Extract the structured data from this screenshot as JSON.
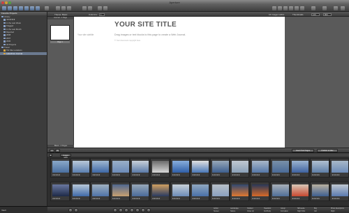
{
  "window": {
    "title": "Aperture"
  },
  "sidebar": {
    "header": "Favorite Projects",
    "items": [
      {
        "label": "Library",
        "sel": false
      },
      {
        "label": "★★★★★",
        "sel": false
      },
      {
        "label": "In the Last Week",
        "sel": false
      },
      {
        "label": "Flagged",
        "sel": false
      },
      {
        "label": "In the Last Month",
        "sel": false
      },
      {
        "label": "Rejected",
        "sel": false
      },
      {
        "label": "2008",
        "sel": false
      },
      {
        "label": "2007",
        "sel": false
      },
      {
        "label": "2006",
        "sel": false
      },
      {
        "label": "All Projects",
        "sel": false
      },
      {
        "label": "Travel",
        "sel": false
      },
      {
        "label": "Tiki Site Locations",
        "sel": false
      },
      {
        "label": "Lakeshore Journal",
        "sel": true
      }
    ],
    "footer": "Vault"
  },
  "book_toolbar": {
    "theme_label": "Theme: Basic",
    "columns_label": "Columns:",
    "columns_value": "1",
    "images_label": "16 images within",
    "thumb_label": "Thumbnails",
    "size_value": "120",
    "size_value2": "800"
  },
  "pages_panel": {
    "header": "Journal - 1 Page",
    "thumb_label": "Page 1",
    "footer": "Blank - 4 Pages"
  },
  "canvas": {
    "title": "YOUR SITE TITLE",
    "subtitle": "Your site subtitle",
    "drag_text": "Drag images or text blocks to this page to create a Web Journal.",
    "copyright": "© Your document copyright here"
  },
  "browser_toolbar": {
    "insert_label": "Insert Text Pages",
    "publish_label": "Publish to Mac",
    "filter_label": "Images Grid"
  },
  "browser": {
    "thumbnails": [
      {
        "rating": "★★★★★",
        "c1": "#4a6fa0",
        "c2": "#8aa8c8"
      },
      {
        "rating": "★★★★★",
        "c1": "#5b7fb0",
        "c2": "#b8c8d8"
      },
      {
        "rating": "★★★★★",
        "c1": "#3e68a6",
        "c2": "#a0b8d0"
      },
      {
        "rating": "★★★★★",
        "c1": "#6b8ab8",
        "c2": "#9ab0c8"
      },
      {
        "rating": "★★★★★",
        "c1": "#5a7aa8",
        "c2": "#c8d0d8"
      },
      {
        "rating": "★★★★★",
        "c1": "#d8d8d8",
        "c2": "#6a6a6a"
      },
      {
        "rating": "★★★★★",
        "c1": "#2f5fa8",
        "c2": "#88aedc"
      },
      {
        "rating": "★★★★★",
        "c1": "#4a78b8",
        "c2": "#e0e0e0"
      },
      {
        "rating": "★★★★★",
        "c1": "#3d5f8f",
        "c2": "#98a8b8"
      },
      {
        "rating": "★★★★★",
        "c1": "#8aa0b8",
        "c2": "#c0c8d0"
      },
      {
        "rating": "★★★★★",
        "c1": "#5577a8",
        "c2": "#aab8c8"
      },
      {
        "rating": "★★★★★",
        "c1": "#4a6a98",
        "c2": "#7890a8"
      },
      {
        "rating": "★★★★★",
        "c1": "#3e62a0",
        "c2": "#9cb4d0"
      },
      {
        "rating": "★★★★★",
        "c1": "#5f7fa8",
        "c2": "#b0c0d0"
      },
      {
        "rating": "★★★★★",
        "c1": "#6c8bb8",
        "c2": "#a8b8c8"
      },
      {
        "rating": "★★★★★",
        "c1": "#1e2a48",
        "c2": "#6a78a0"
      },
      {
        "rating": "★★★★★",
        "c1": "#3f6aa8",
        "c2": "#b8c8d8"
      },
      {
        "rating": "★★★★★",
        "c1": "#4f73a8",
        "c2": "#a0b0c0"
      },
      {
        "rating": "★★★★★",
        "c1": "#c8a070",
        "c2": "#506890"
      },
      {
        "rating": "★★★★★",
        "c1": "#4a6a9a",
        "c2": "#98a8b8"
      },
      {
        "rating": "★★★★★",
        "c1": "#2a3a60",
        "c2": "#d0a060"
      },
      {
        "rating": "★★★★★",
        "c1": "#6c8cb8",
        "c2": "#c8d0d8"
      },
      {
        "rating": "★★★★★",
        "c1": "#4a70a8",
        "c2": "#90a8c0"
      },
      {
        "rating": "★★★★★",
        "c1": "#8aa0c0",
        "c2": "#b8c0c8"
      },
      {
        "rating": "★★★★★",
        "c1": "#e07830",
        "c2": "#304870"
      },
      {
        "rating": "★★★★★",
        "c1": "#d86a28",
        "c2": "#283858"
      },
      {
        "rating": "★★★★★",
        "c1": "#506e98",
        "c2": "#a8b0b8"
      },
      {
        "rating": "★★★★★",
        "c1": "#c84830",
        "c2": "#d8c8b8"
      },
      {
        "rating": "★★★★★",
        "c1": "#3e5f90",
        "c2": "#b8b0a0"
      },
      {
        "rating": "★★★★★",
        "c1": "#5a7ab0",
        "c2": "#c0c8d0"
      }
    ]
  },
  "bottombar": {
    "keywords": [
      "Action",
      "Landscape",
      "Outdoor",
      "Headshot",
      "Group",
      "Silhouette",
      "Boy",
      "Photo Descriptors",
      "Sunset",
      "Nature",
      "Close Up",
      "Full Body",
      "Formation",
      "Night Shot",
      "Girl",
      "Right"
    ]
  },
  "colors": {
    "canvas": "#ffffff",
    "accent": "#6b7a90"
  }
}
